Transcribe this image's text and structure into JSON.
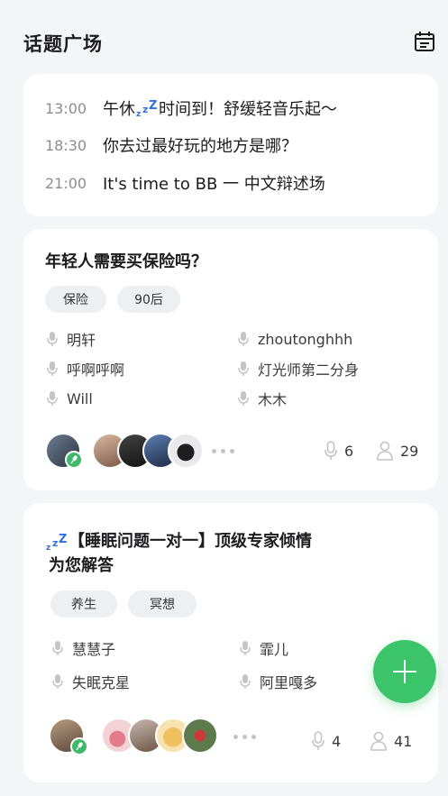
{
  "header": {
    "title": "话题广场",
    "calendar_icon": "calendar-icon"
  },
  "schedule": [
    {
      "time": "13:00",
      "title_before": "午休",
      "title_after": "时间到！舒缓轻音乐起～",
      "has_zzz": true
    },
    {
      "time": "18:30",
      "title_before": "你去过最好玩的地方是哪？",
      "title_after": "",
      "has_zzz": false
    },
    {
      "time": "21:00",
      "title_before": "It's time to BB 一 中文辩述场",
      "title_after": "",
      "has_zzz": false
    }
  ],
  "topics": [
    {
      "title_line1": "年轻人需要买保险吗？",
      "title_line2": "",
      "tags": [
        "保险",
        "90后"
      ],
      "speakers": [
        "明轩",
        "zhoutonghhh",
        "呼啊呼啊",
        "灯光师第二分身",
        "Will",
        "木木"
      ],
      "speaker_count": "6",
      "listener_count": "29"
    },
    {
      "title_line1": "【睡眠问题一对一】顶级专家倾情",
      "title_line2": "为您解答",
      "tags": [
        "养生",
        "冥想"
      ],
      "speakers": [
        "慧慧子",
        "霏儿",
        "失眠克星",
        "阿里嘎多"
      ],
      "speaker_count": "4",
      "listener_count": "41"
    }
  ],
  "colors": {
    "accent": "#3cc46b",
    "zzz": "#2f6fe0",
    "card": "#ffffff",
    "background": "#f4f5f7"
  }
}
